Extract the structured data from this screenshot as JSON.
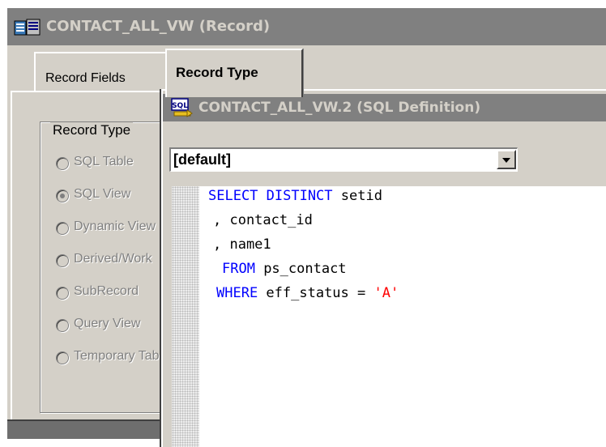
{
  "back_window": {
    "title": "CONTACT_ALL_VW (Record)",
    "tabs": [
      {
        "label": "Record Fields",
        "active": false
      },
      {
        "label": "Record Type",
        "active": true
      }
    ],
    "record_type_group": {
      "legend": "Record Type",
      "options": [
        {
          "label": "SQL Table",
          "selected": false
        },
        {
          "label": "SQL View",
          "selected": true
        },
        {
          "label": "Dynamic View",
          "selected": false
        },
        {
          "label": "Derived/Work",
          "selected": false
        },
        {
          "label": "SubRecord",
          "selected": false
        },
        {
          "label": "Query View",
          "selected": false
        },
        {
          "label": "Temporary Table",
          "selected": false
        }
      ]
    }
  },
  "sql_window": {
    "title": "CONTACT_ALL_VW.2 (SQL Definition)",
    "icon_label": "SQL",
    "dropdown": {
      "value": "[default]"
    },
    "code": {
      "line1": {
        "kw": "SELECT DISTINCT",
        "rest": " setid"
      },
      "line2": {
        "text": ", contact_id"
      },
      "line3": {
        "text": ", name1"
      },
      "line4": {
        "kw": "FROM",
        "rest": " ps_contact"
      },
      "line5": {
        "kw": "WHERE",
        "rest": " eff_status = ",
        "literal": "'A'"
      }
    }
  },
  "colors": {
    "sql_keyword": "#0000ff",
    "sql_string": "#ff0000",
    "inactive_titlebar": "#808080",
    "window_face": "#d4d0c8"
  }
}
